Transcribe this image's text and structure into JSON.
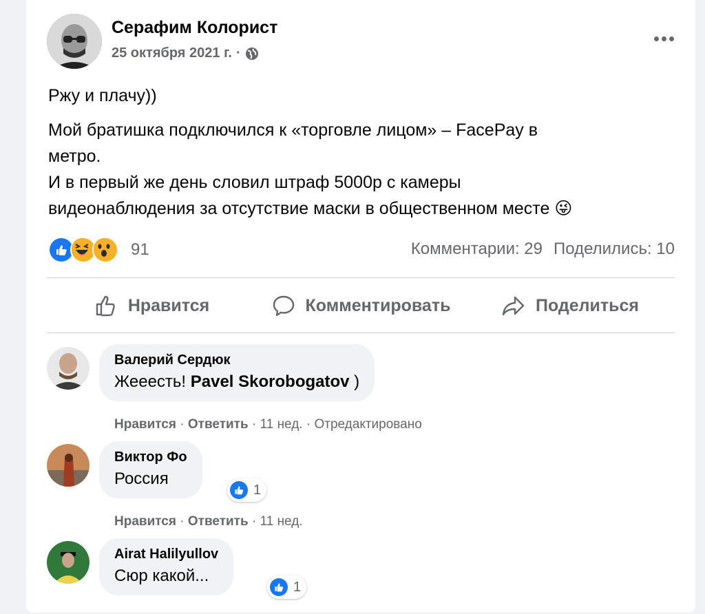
{
  "post": {
    "author": "Серафим Колорист",
    "date": "25 октября 2021 г.",
    "date_separator": "·",
    "text_line1": "Ржу и плачу))",
    "text_line2a": "Мой братишка подключился к «торговле лицом» – FacePay в",
    "text_line2b": "метро.",
    "text_line3a": "И в первый же день словил штраф 5000р с камеры",
    "text_line3b": "видеонаблюдения за отсутствие маски в общественном месте 😜"
  },
  "stats": {
    "reaction_count": "91",
    "comments": "Комментарии: 29",
    "shares": "Поделились: 10"
  },
  "actions": {
    "like": "Нравится",
    "comment": "Комментировать",
    "share": "Поделиться"
  },
  "comments": [
    {
      "name": "Валерий Сердюк",
      "text_prefix": "Жееесть! ",
      "mention": "Pavel Skorobogatov",
      "text_suffix": " )",
      "like": "Нравится",
      "reply": "Ответить",
      "time": "11 нед.",
      "edited": "Отредактировано"
    },
    {
      "name": "Виктор Фо",
      "text": "Россия",
      "reactions": "1",
      "like": "Нравится",
      "reply": "Ответить",
      "time": "11 нед."
    },
    {
      "name": "Airat Halilyullov",
      "text": "Сюр какой...",
      "reactions": "1"
    }
  ],
  "meta_separator": "·",
  "colors": {
    "accent": "#1877f2",
    "secondary_text": "#65676b",
    "bubble": "#f0f2f5"
  },
  "icons": [
    "globe-icon",
    "more-icon",
    "like-reaction-icon",
    "haha-reaction-icon",
    "wow-reaction-icon",
    "thumbs-up-icon",
    "comment-icon",
    "share-icon"
  ]
}
